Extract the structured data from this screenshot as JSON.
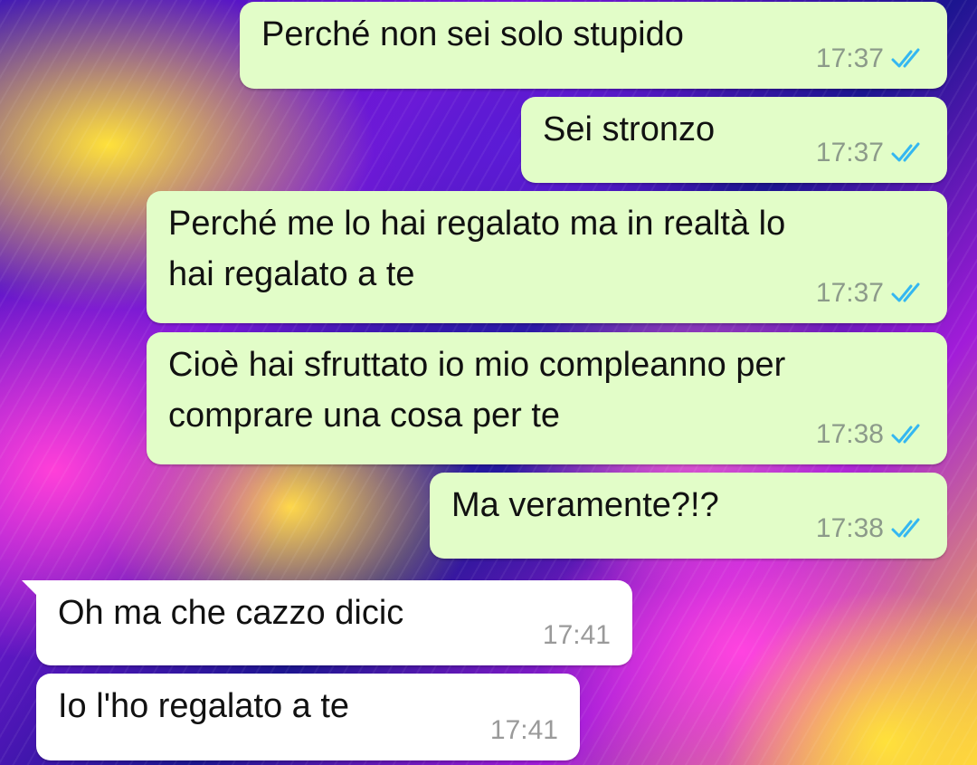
{
  "theme": {
    "outgoing_bubble": "#e2fdc8",
    "incoming_bubble": "#ffffff",
    "read_tick": "#34b7f1"
  },
  "messages": [
    {
      "direction": "out",
      "text": "Perché non sei solo stupido",
      "time": "17:37",
      "status": "read",
      "status_icon": "double-check-icon"
    },
    {
      "direction": "out",
      "text": "Sei stronzo",
      "time": "17:37",
      "status": "read",
      "status_icon": "double-check-icon"
    },
    {
      "direction": "out",
      "text": "Perché me lo hai regalato ma in realtà lo\nhai regalato a te",
      "time": "17:37",
      "status": "read",
      "status_icon": "double-check-icon"
    },
    {
      "direction": "out",
      "text": "Cioè hai sfruttato io mio compleanno per\ncomprare una cosa per te",
      "time": "17:38",
      "status": "read",
      "status_icon": "double-check-icon"
    },
    {
      "direction": "out",
      "text": "Ma veramente?!?",
      "time": "17:38",
      "status": "read",
      "status_icon": "double-check-icon"
    },
    {
      "direction": "in",
      "text": "Oh ma che cazzo dicic",
      "time": "17:41"
    },
    {
      "direction": "in",
      "text": "Io l'ho regalato a te",
      "time": "17:41"
    }
  ]
}
